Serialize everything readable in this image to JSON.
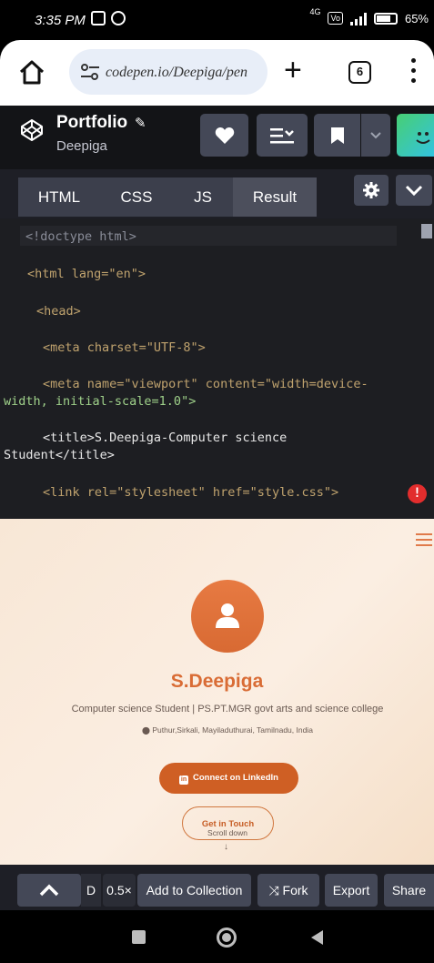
{
  "status_bar": {
    "time": "3:35 PM",
    "network": "4G",
    "battery": "65%"
  },
  "browser": {
    "url": "codepen.io/Deepiga/pen",
    "tab_count": "6"
  },
  "pen": {
    "title": "Portfolio",
    "author": "Deepiga"
  },
  "editor_tabs": [
    "HTML",
    "CSS",
    "JS",
    "Result"
  ],
  "code_lines": [
    "<!doctype html>",
    "<html lang=\"en\">",
    "<head>",
    "<meta charset=\"UTF-8\">",
    "<meta name=\"viewport\" content=\"width=device-",
    "width, initial-scale=1.0\">",
    "<title>S.Deepiga-Computer science",
    "Student</title>",
    "<link rel=\"stylesheet\" href=\"style.css\">"
  ],
  "preview": {
    "name": "S.Deepiga",
    "subtitle": "Computer science Student | PS.PT.MGR govt arts and science college",
    "location": "Puthur,Sirkali, Mayiladuthurai, Tamilnadu, India",
    "linkedin_label": "Connect on LinkedIn",
    "touch_label": "Get in Touch",
    "scroll_label": "Scroll down",
    "accent_color": "#d96c35"
  },
  "bottom_bar": {
    "d_label": "D",
    "zoom": "0.5×",
    "collection_label": "Add to Collection",
    "fork_label": "Fork",
    "export_label": "Export",
    "share_label": "Share"
  }
}
